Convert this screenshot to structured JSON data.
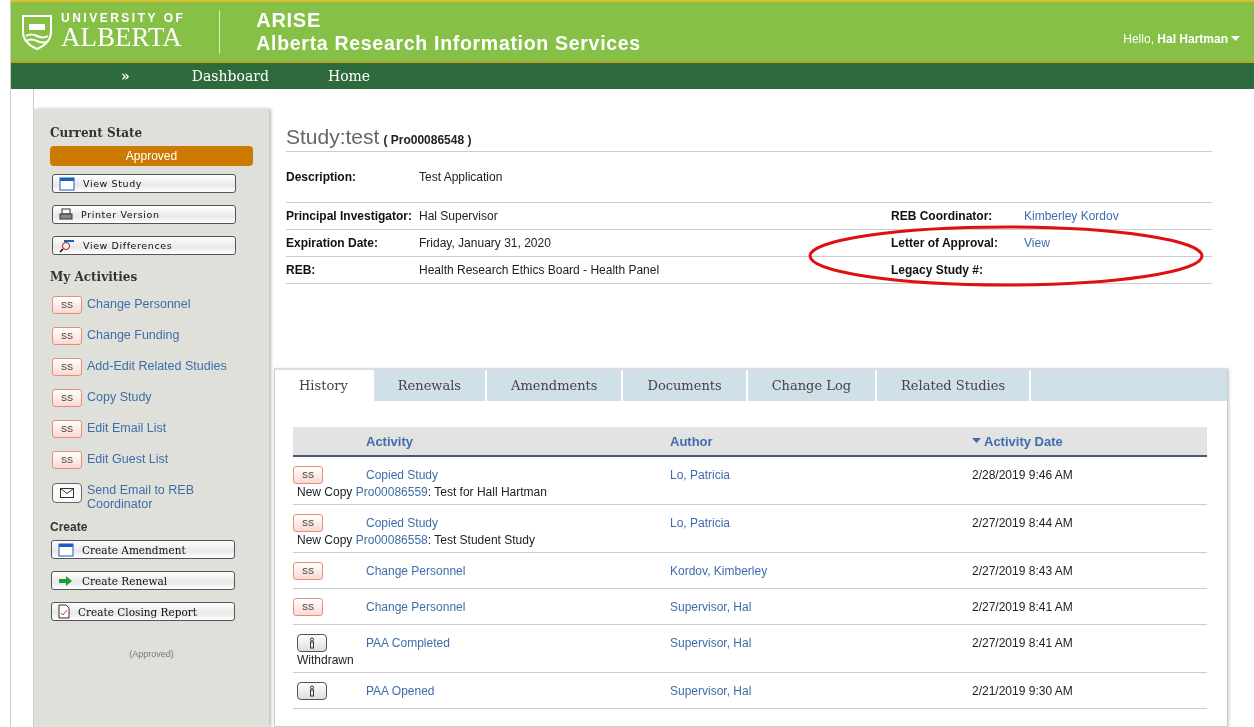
{
  "header": {
    "logo_top": "UNIVERSITY OF",
    "logo_bottom": "ALBERTA",
    "app_name": "ARISE",
    "app_full": "Alberta Research Information Services",
    "greeting": "Hello,",
    "user": "Hal Hartman"
  },
  "nav": [
    {
      "label": "»",
      "kind": "toggle"
    },
    {
      "label": "Dashboard",
      "kind": "link"
    },
    {
      "label": "Home",
      "kind": "link"
    }
  ],
  "sidebar": {
    "state_heading": "Current State",
    "state": "Approved",
    "buttons": [
      {
        "label": "View Study",
        "kind": "window"
      },
      {
        "label": "Printer Version",
        "kind": "printer"
      },
      {
        "label": "View Differences",
        "kind": "diff"
      }
    ],
    "activities_heading": "My Activities",
    "activities": [
      {
        "label": "Change Personnel",
        "kind": "ss",
        "badge": "SS"
      },
      {
        "label": "Change Funding",
        "kind": "ss",
        "badge": "SS"
      },
      {
        "label": "Add-Edit Related Studies",
        "kind": "ss",
        "badge": "SS"
      },
      {
        "label": "Copy Study",
        "kind": "ss",
        "badge": "SS"
      },
      {
        "label": "Edit Email List",
        "kind": "ss",
        "badge": "SS"
      },
      {
        "label": "Edit Guest List",
        "kind": "ss",
        "badge": "SS"
      },
      {
        "label": "Send Email to REB Coordinator",
        "kind": "mail"
      }
    ],
    "create_heading": "Create",
    "create": [
      {
        "label": "Create Amendment",
        "kind": "window"
      },
      {
        "label": "Create Renewal",
        "kind": "arrow"
      },
      {
        "label": "Create Closing Report",
        "kind": "report"
      }
    ],
    "footer": "(Approved)"
  },
  "study": {
    "title": "Study:test",
    "id": "( Pro00086548 )",
    "description_label": "Description:",
    "description": "Test Application",
    "fields": [
      [
        {
          "label": "Principal Investigator:",
          "value": "Hal Supervisor",
          "link": false
        },
        {
          "label": "REB Coordinator:",
          "value": "Kimberley Kordov",
          "link": true
        }
      ],
      [
        {
          "label": "Expiration Date:",
          "value": "Friday, January 31, 2020",
          "link": false
        },
        {
          "label": "Letter of Approval:",
          "value": "View",
          "link": true
        }
      ],
      [
        {
          "label": "REB:",
          "value": "Health Research Ethics Board - Health Panel",
          "link": false
        },
        {
          "label": "Legacy Study #:"
        }
      ]
    ]
  },
  "tabs": [
    {
      "label": "History",
      "selected": true
    },
    {
      "label": "Renewals",
      "selected": false
    },
    {
      "label": "Amendments",
      "selected": false
    },
    {
      "label": "Documents",
      "selected": false
    },
    {
      "label": "Change Log",
      "selected": false
    },
    {
      "label": "Related Studies",
      "selected": false
    }
  ],
  "table": {
    "columns": [
      {
        "label": "Activity",
        "sorted": false
      },
      {
        "label": "Author",
        "sorted": false
      },
      {
        "label": "Activity Date",
        "sorted": true
      }
    ],
    "rows": [
      {
        "kind": "ss",
        "badge": "SS",
        "activity": "Copied Study",
        "author": "Lo, Patricia",
        "date": "2/28/2019 9:46 AM",
        "note": {
          "prefix": "New Copy",
          "link": "Pro00086559",
          "suffix": ": Test for Hall Hartman"
        }
      },
      {
        "kind": "ss",
        "badge": "SS",
        "activity": "Copied Study",
        "author": "Lo, Patricia",
        "date": "2/27/2019 8:44 AM",
        "note": {
          "prefix": "New Copy",
          "link": "Pro00086558",
          "suffix": ": Test Student Study"
        }
      },
      {
        "kind": "ss",
        "badge": "SS",
        "activity": "Change Personnel",
        "author": "Kordov, Kimberley",
        "date": "2/27/2019 8:43 AM"
      },
      {
        "kind": "ss",
        "badge": "SS",
        "activity": "Change Personnel",
        "author": "Supervisor, Hal",
        "date": "2/27/2019 8:41 AM"
      },
      {
        "kind": "info",
        "activity": "PAA Completed",
        "author": "Supervisor, Hal",
        "date": "2/27/2019 8:41 AM",
        "note": {
          "prefix": "Withdrawn"
        }
      },
      {
        "kind": "info",
        "activity": "PAA Opened",
        "author": "Supervisor, Hal",
        "date": "2/21/2019 9:30 AM"
      }
    ]
  }
}
